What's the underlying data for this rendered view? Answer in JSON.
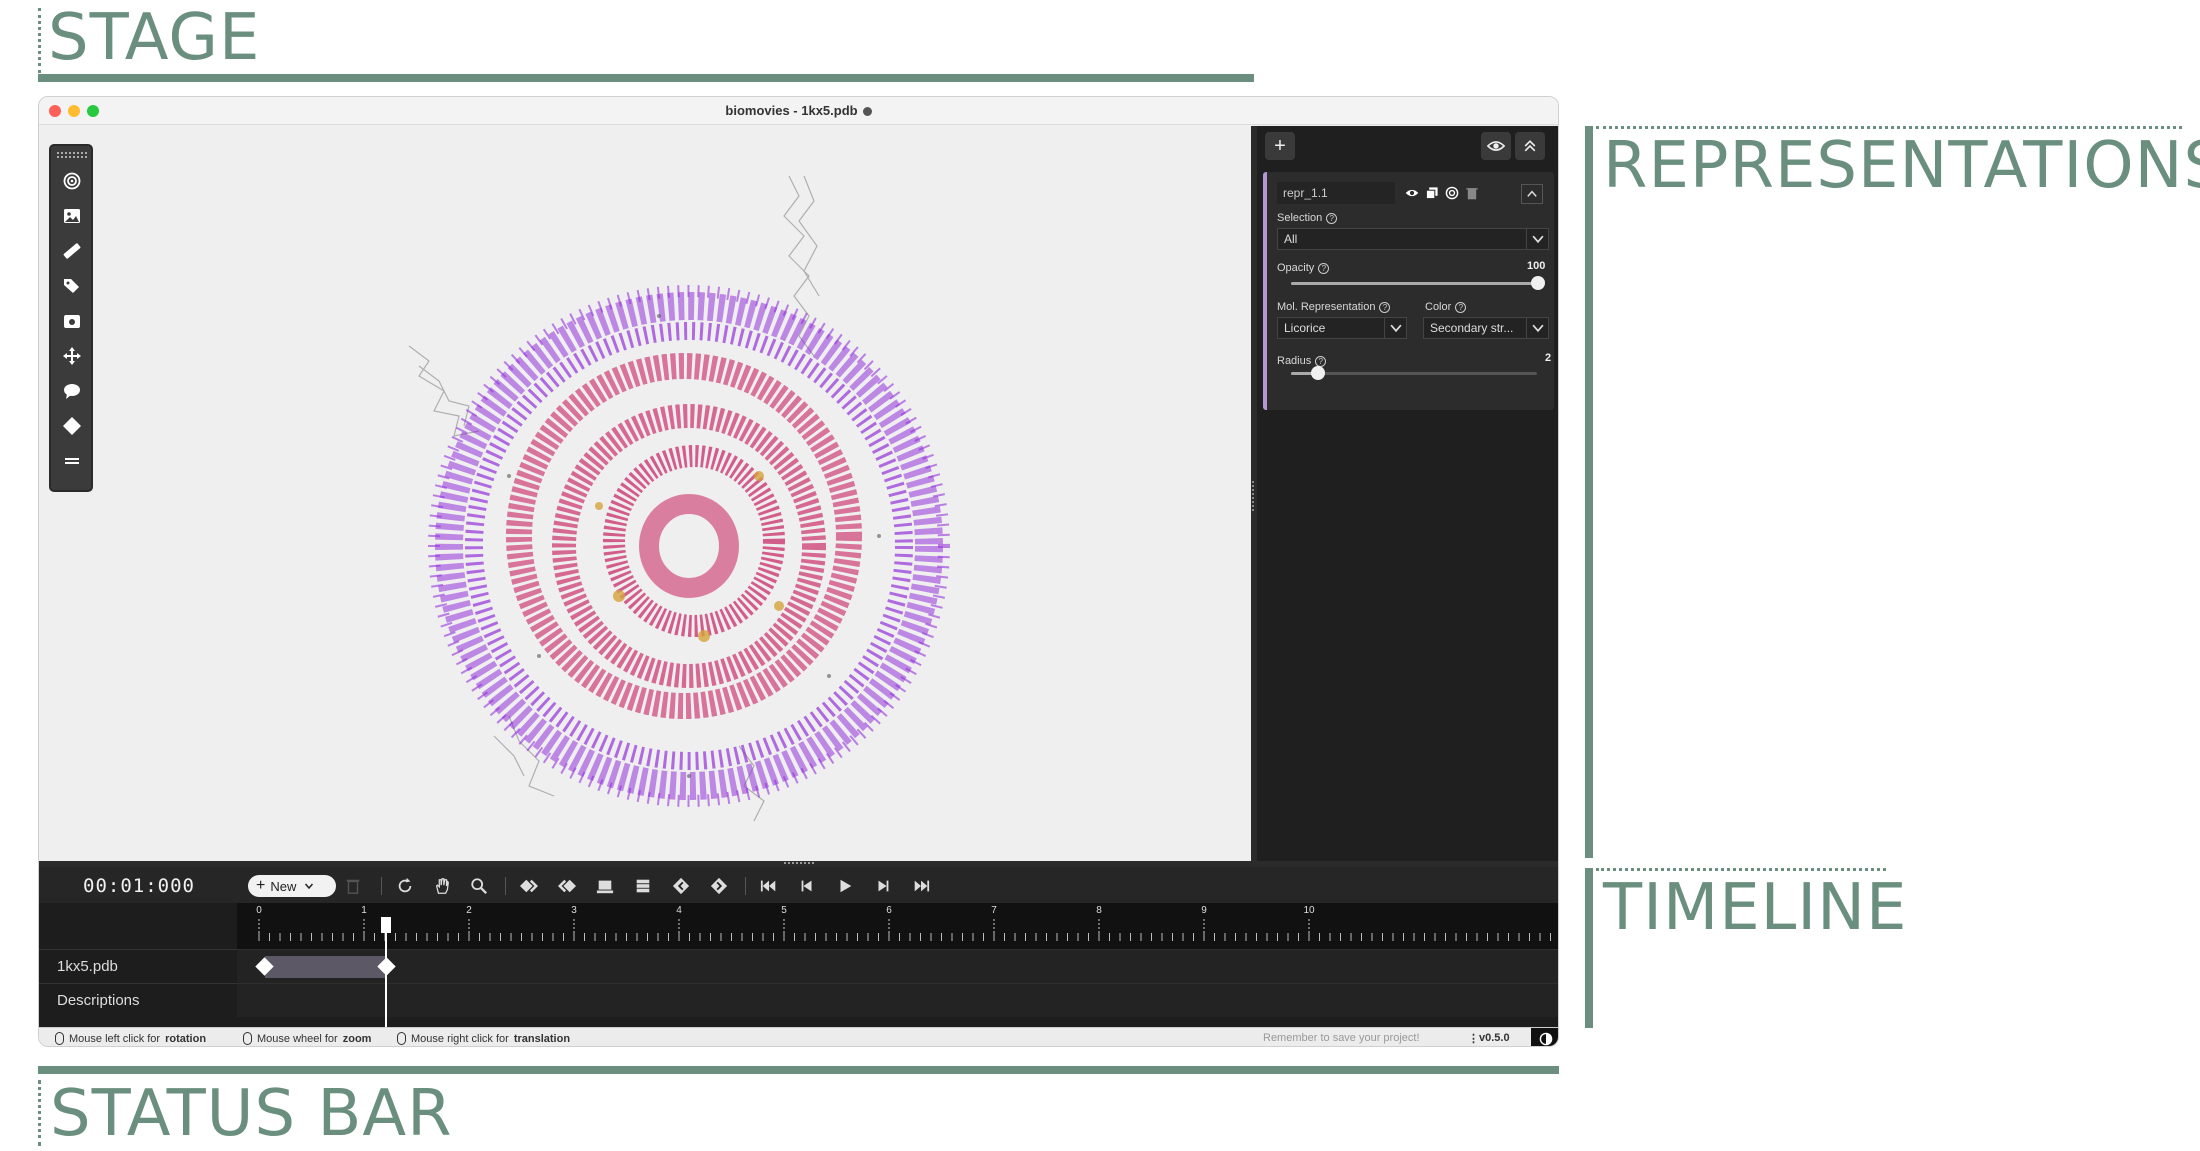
{
  "annotations": {
    "stage": "STAGE",
    "representations": "REPRESENTATIONS",
    "timeline": "TIMELINE",
    "status_bar": "STATUS BAR"
  },
  "window": {
    "title": "biomovies - 1kx5.pdb",
    "traffic_colors": [
      "#fe5f57",
      "#febc2e",
      "#28c840"
    ]
  },
  "stage_toolbar": {
    "icons": [
      "target-icon",
      "image-icon",
      "ruler-icon",
      "tags-icon",
      "camera-icon",
      "move-icon",
      "comment-icon",
      "keyframe-icon",
      "menu-icon"
    ]
  },
  "representations": {
    "add_label": "+",
    "items": [
      {
        "name": "repr_1.1",
        "selection_label": "Selection",
        "selection_value": "All",
        "opacity_label": "Opacity",
        "opacity_value": "100",
        "mol_repr_label": "Mol. Representation",
        "mol_repr_value": "Licorice",
        "color_label": "Color",
        "color_value": "Secondary str...",
        "radius_label": "Radius",
        "radius_value": "2"
      }
    ]
  },
  "timeline": {
    "timecode": "00:01:000",
    "new_label": "New",
    "ruler_labels": [
      "0",
      "1",
      "2",
      "3",
      "4",
      "5",
      "6",
      "7",
      "8",
      "9",
      "10"
    ],
    "tracks": [
      {
        "label": "1kx5.pdb"
      },
      {
        "label": "Descriptions"
      }
    ]
  },
  "status": {
    "hint1_prefix": "Mouse left click for",
    "hint1_bold": "rotation",
    "hint2_prefix": "Mouse wheel for",
    "hint2_bold": "zoom",
    "hint3_prefix": "Mouse right click for",
    "hint3_bold": "translation",
    "save_reminder": "Remember to save your project!",
    "version": "v0.5.0"
  },
  "colors": {
    "accent": "#6b8f7e",
    "protein_magenta": "#d1205f",
    "dna_purple": "#8a1ed8",
    "repr_accent": "#b596d3"
  }
}
